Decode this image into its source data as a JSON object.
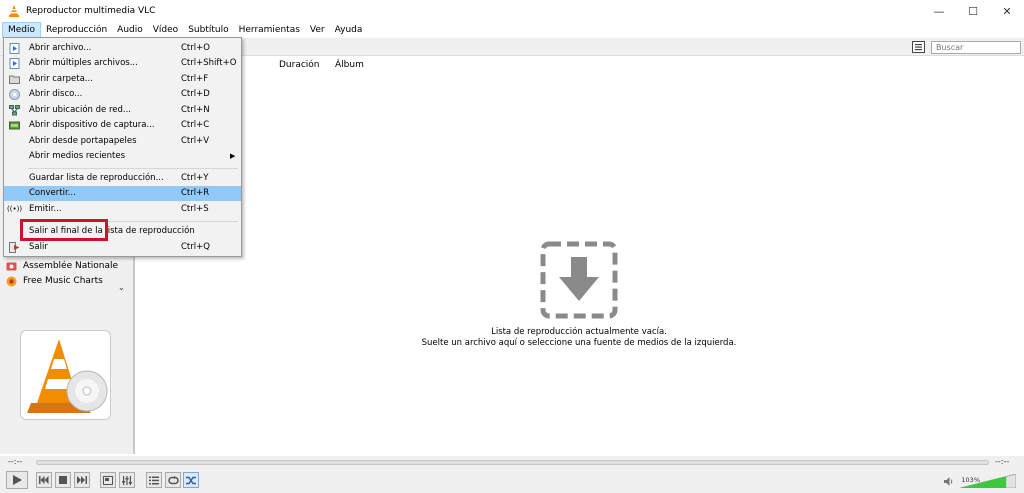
{
  "window": {
    "title": "Reproductor multimedia VLC",
    "minimize": "—",
    "maximize": "☐",
    "close": "✕"
  },
  "menubar": {
    "items": [
      "Medio",
      "Reproducción",
      "Audio",
      "Vídeo",
      "Subtítulo",
      "Herramientas",
      "Ver",
      "Ayuda"
    ],
    "active": "Medio"
  },
  "search": {
    "placeholder": "Buscar"
  },
  "playlist": {
    "columns": [
      "Duración",
      "Álbum"
    ],
    "empty_line1": "Lista de reproducción actualmente vacía.",
    "empty_line2": "Suelte un archivo aquí o seleccione una fuente de medios de la izquierda."
  },
  "sidebar": {
    "items": [
      {
        "label": "Assemblée Nationale",
        "icon": "podcast-icon"
      },
      {
        "label": "Free Music Charts",
        "icon": "music-charts-icon"
      }
    ]
  },
  "media_menu": {
    "items": [
      {
        "label": "Abrir archivo...",
        "shortcut": "Ctrl+O",
        "icon": "file-play-icon"
      },
      {
        "label": "Abrir múltiples archivos...",
        "shortcut": "Ctrl+Shift+O",
        "icon": "file-play-icon"
      },
      {
        "label": "Abrir carpeta...",
        "shortcut": "Ctrl+F",
        "icon": "folder-icon"
      },
      {
        "label": "Abrir disco...",
        "shortcut": "Ctrl+D",
        "icon": "disc-icon"
      },
      {
        "label": "Abrir ubicación de red...",
        "shortcut": "Ctrl+N",
        "icon": "network-icon"
      },
      {
        "label": "Abrir dispositivo de captura...",
        "shortcut": "Ctrl+C",
        "icon": "capture-card-icon"
      },
      {
        "label": "Abrir desde portapapeles",
        "shortcut": "Ctrl+V",
        "icon": ""
      },
      {
        "label": "Abrir medios recientes",
        "shortcut": "",
        "icon": "",
        "submenu": true
      },
      {
        "label": "Guardar lista de reproducción...",
        "shortcut": "Ctrl+Y",
        "icon": ""
      },
      {
        "label": "Convertir...",
        "shortcut": "Ctrl+R",
        "icon": "",
        "highlighted": true
      },
      {
        "label": "Emitir...",
        "shortcut": "Ctrl+S",
        "icon": "stream-icon"
      },
      {
        "label": "Salir al final de la lista de reproducción",
        "shortcut": "",
        "icon": ""
      },
      {
        "label": "Salir",
        "shortcut": "Ctrl+Q",
        "icon": "exit-icon"
      }
    ]
  },
  "seek": {
    "elapsed": "--:--",
    "total": "--:--"
  },
  "volume": {
    "label": "103%",
    "level_percent": 103
  },
  "colors": {
    "highlight": "#91c9f7",
    "annotation": "#d0102c",
    "vlc_orange": "#f28c00",
    "volume_green": "#3cc83c"
  }
}
